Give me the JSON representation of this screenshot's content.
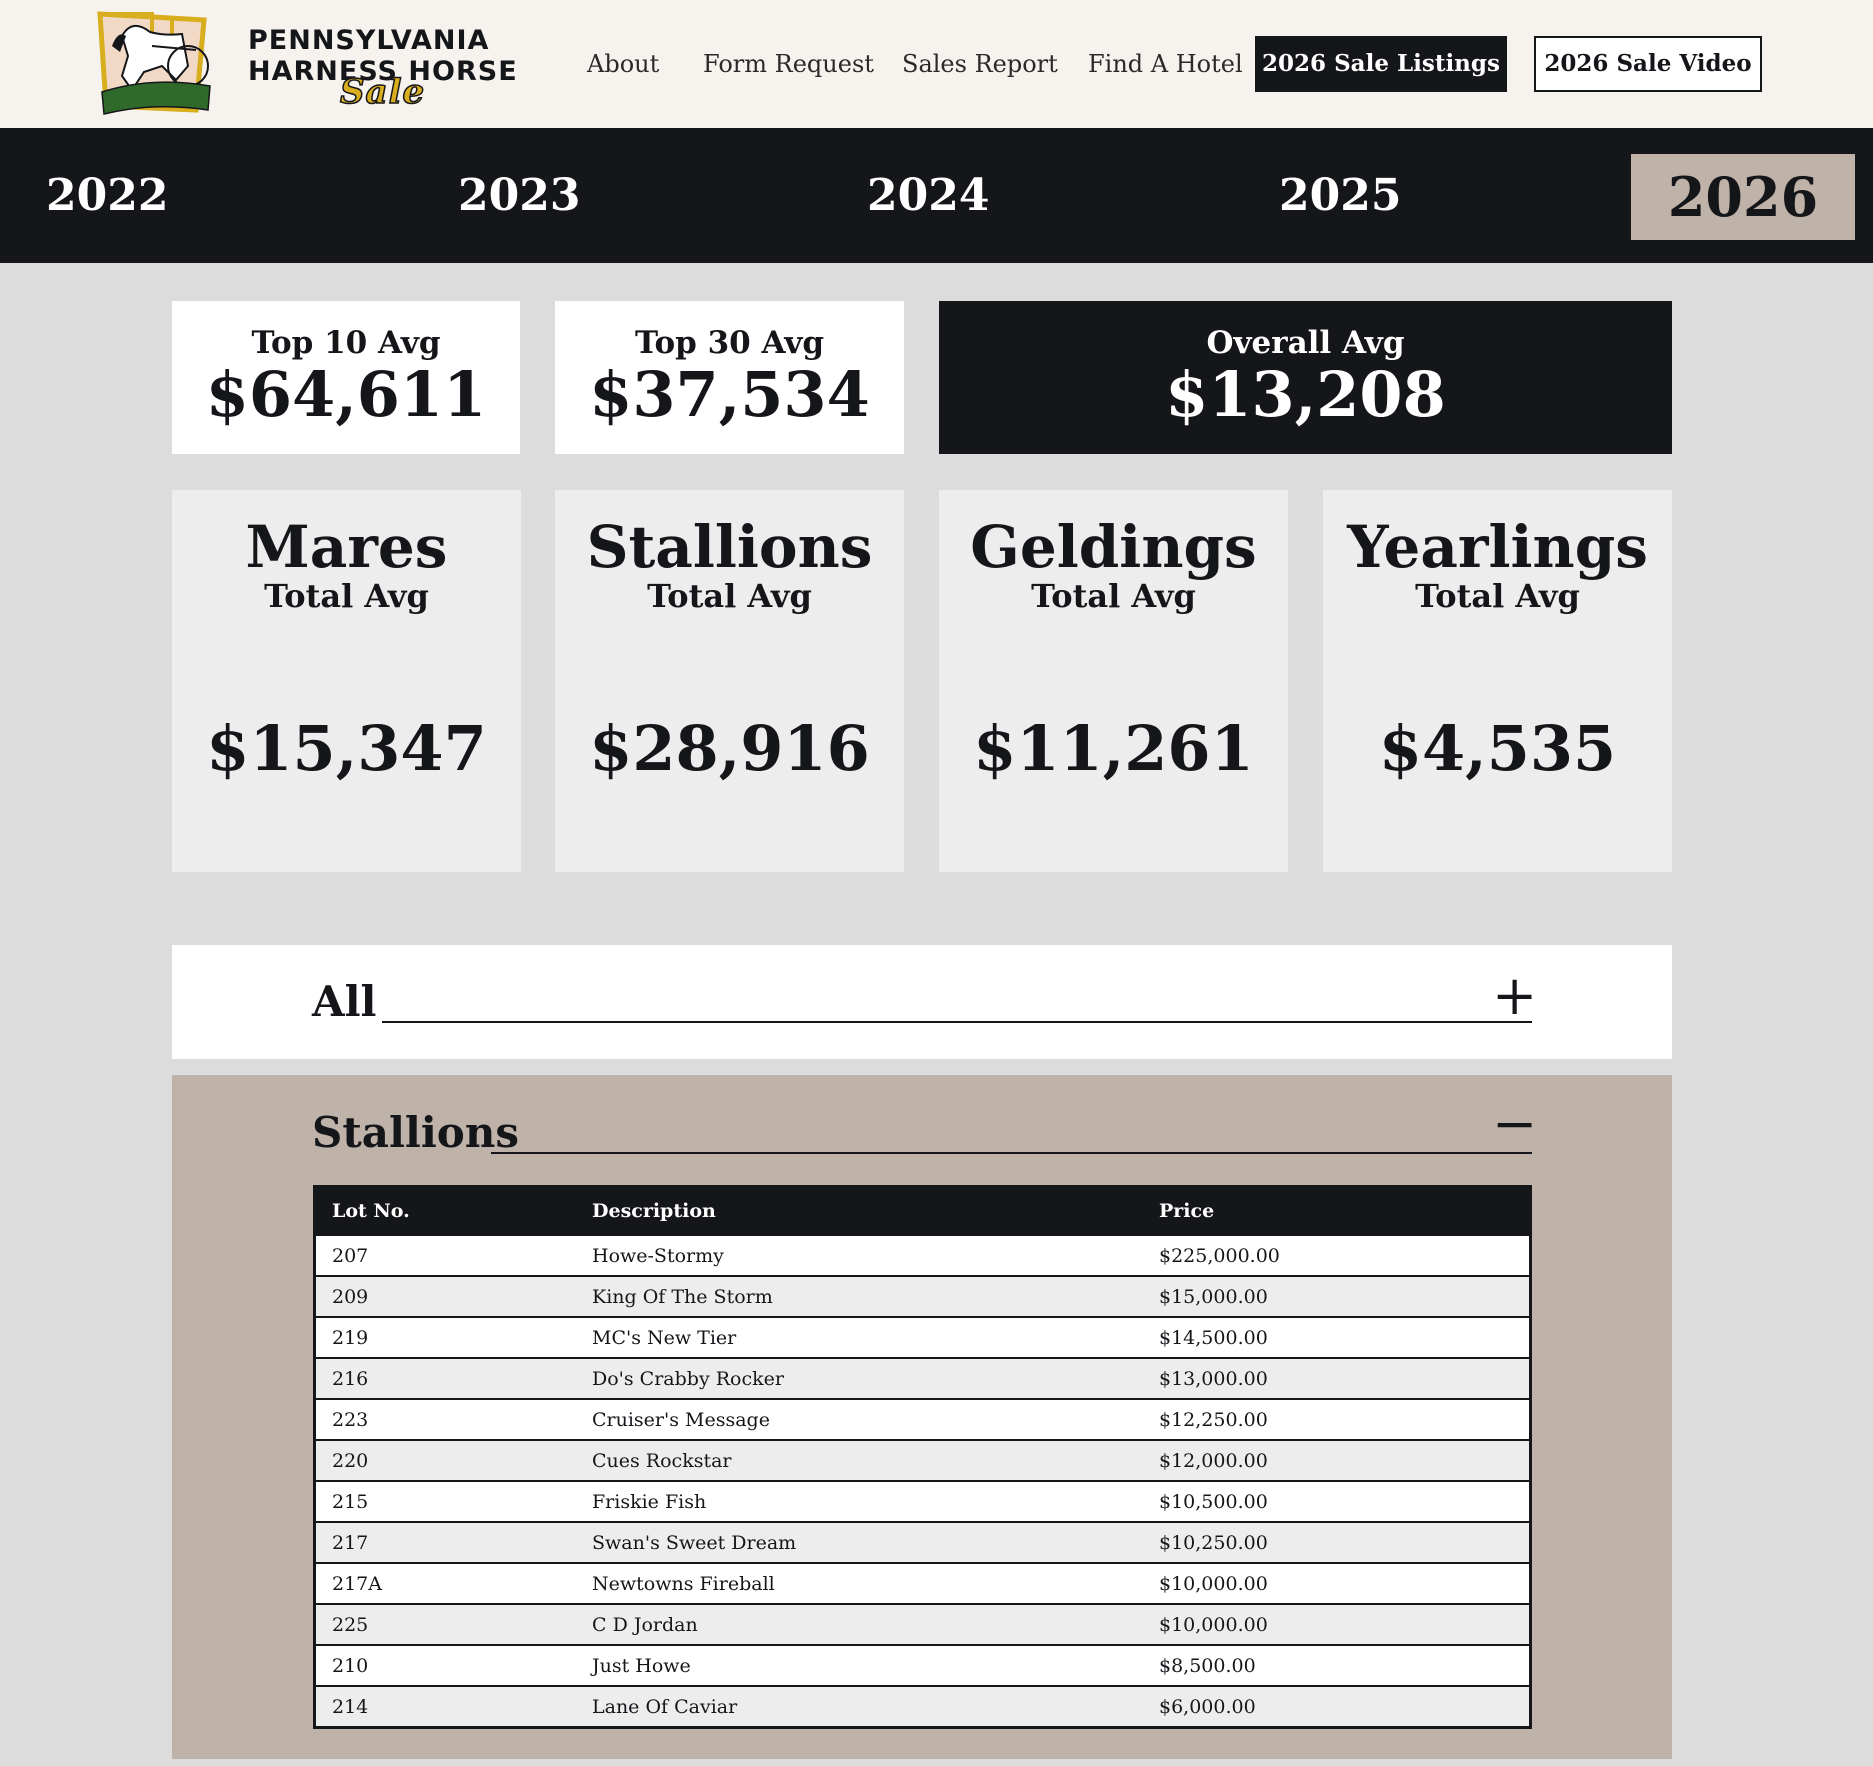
{
  "brand": {
    "line1": "PENNSYLVANIA",
    "line2": "HARNESS HORSE",
    "line3": "Sale"
  },
  "nav": {
    "about": "About",
    "form_request": "Form Request",
    "sales_report": "Sales Report",
    "find_hotel": "Find A Hotel",
    "sale_listings": "2026 Sale Listings",
    "sale_video": "2026 Sale Video"
  },
  "years": [
    "2022",
    "2023",
    "2024",
    "2025",
    "2026"
  ],
  "active_year": "2026",
  "stats": {
    "top10": {
      "label": "Top 10 Avg",
      "value": "$64,611"
    },
    "top30": {
      "label": "Top 30 Avg",
      "value": "$37,534"
    },
    "overall": {
      "label": "Overall Avg",
      "value": "$13,208"
    }
  },
  "categories": [
    {
      "name": "Mares",
      "sub": "Total Avg",
      "value": "$15,347"
    },
    {
      "name": "Stallions",
      "sub": "Total Avg",
      "value": "$28,916"
    },
    {
      "name": "Geldings",
      "sub": "Total Avg",
      "value": "$11,261"
    },
    {
      "name": "Yearlings",
      "sub": "Total Avg",
      "value": "$4,535"
    }
  ],
  "sections": {
    "all": {
      "title": "All",
      "toggle": "+"
    },
    "stallions": {
      "title": "Stallions",
      "toggle": "−"
    }
  },
  "table": {
    "headers": [
      "Lot No.",
      "Description",
      "Price"
    ],
    "rows": [
      [
        "207",
        "Howe-Stormy",
        "$225,000.00"
      ],
      [
        "209",
        "King Of The Storm",
        "$15,000.00"
      ],
      [
        "219",
        "MC's New Tier",
        "$14,500.00"
      ],
      [
        "216",
        "Do's Crabby Rocker",
        "$13,000.00"
      ],
      [
        "223",
        "Cruiser's Message",
        "$12,250.00"
      ],
      [
        "220",
        "Cues Rockstar",
        "$12,000.00"
      ],
      [
        "215",
        "Friskie Fish",
        "$10,500.00"
      ],
      [
        "217",
        "Swan's Sweet Dream",
        "$10,250.00"
      ],
      [
        "217A",
        "Newtowns Fireball",
        "$10,000.00"
      ],
      [
        "225",
        "C D Jordan",
        "$10,000.00"
      ],
      [
        "210",
        "Just Howe",
        "$8,500.00"
      ],
      [
        "214",
        "Lane Of Caviar",
        "$6,000.00"
      ]
    ]
  },
  "colors": {
    "dark": "#15161a",
    "tan": "#bfb2a8",
    "header_bg": "#f6f2ee",
    "page_bg": "#dcdcdc",
    "gold": "#d8ae1f",
    "green": "#2f6a2b"
  }
}
